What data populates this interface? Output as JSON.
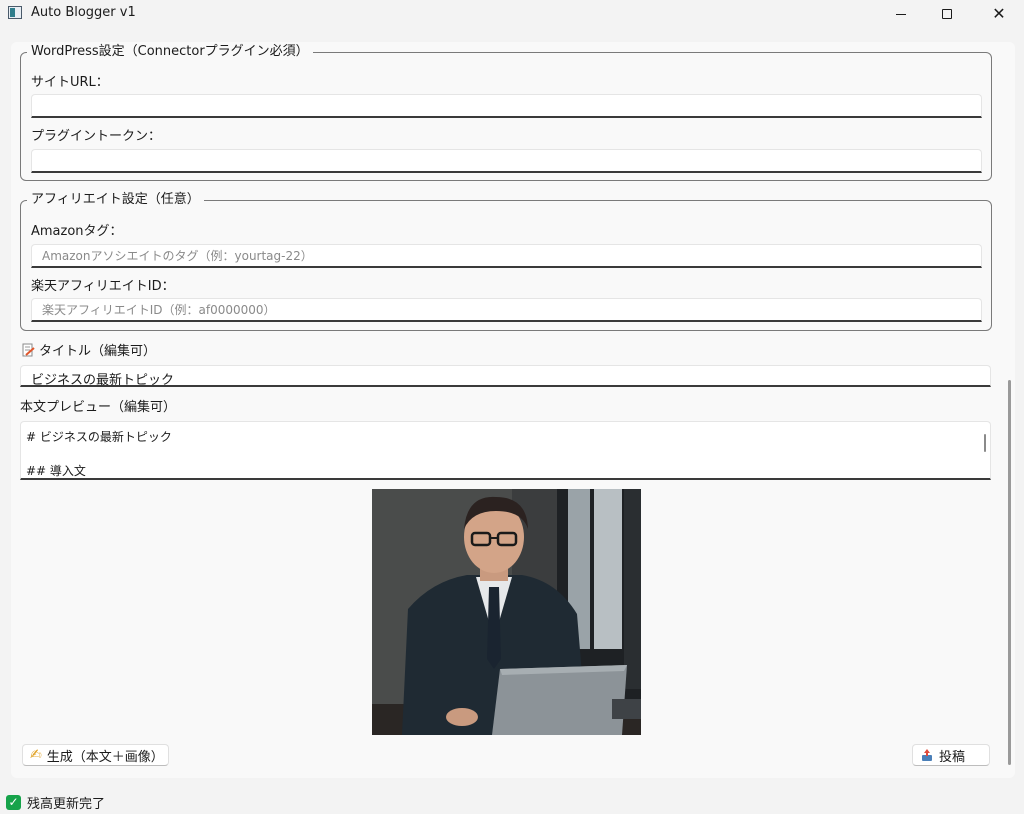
{
  "window": {
    "title": "Auto Blogger v1",
    "minimize_icon": "minimize-icon",
    "maximize_icon": "maximize-icon",
    "close_icon": "close-icon"
  },
  "wordpress": {
    "group_title": "WordPress設定（Connectorプラグイン必須）",
    "site_url_label": "サイトURL：",
    "site_url_value": "",
    "token_label": "プラグイントークン：",
    "token_value": ""
  },
  "affiliate": {
    "group_title": "アフィリエイト設定（任意）",
    "amazon_label": "Amazonタグ：",
    "amazon_placeholder": "Amazonアソシエイトのタグ（例：yourtag-22）",
    "rakuten_label": "楽天アフィリエイトID：",
    "rakuten_placeholder": "楽天アフィリエイトID（例：af0000000）"
  },
  "post": {
    "title_label": "タイトル（編集可）",
    "title_icon": "memo-icon",
    "title_value": "ビジネスの最新トピック",
    "preview_label": "本文プレビュー（編集可）",
    "preview_line1": "# ビジネスの最新トピック",
    "preview_line2": "## 導入文"
  },
  "image": {
    "subject": "business-man-with-laptop-image"
  },
  "actions": {
    "generate_label": "生成（本文＋画像）",
    "generate_icon": "writing-hand-icon",
    "post_label": "投稿",
    "post_icon": "outbox-tray-icon"
  },
  "status": {
    "text": "残高更新完了",
    "icon": "check-icon",
    "color": "#16a34a"
  }
}
